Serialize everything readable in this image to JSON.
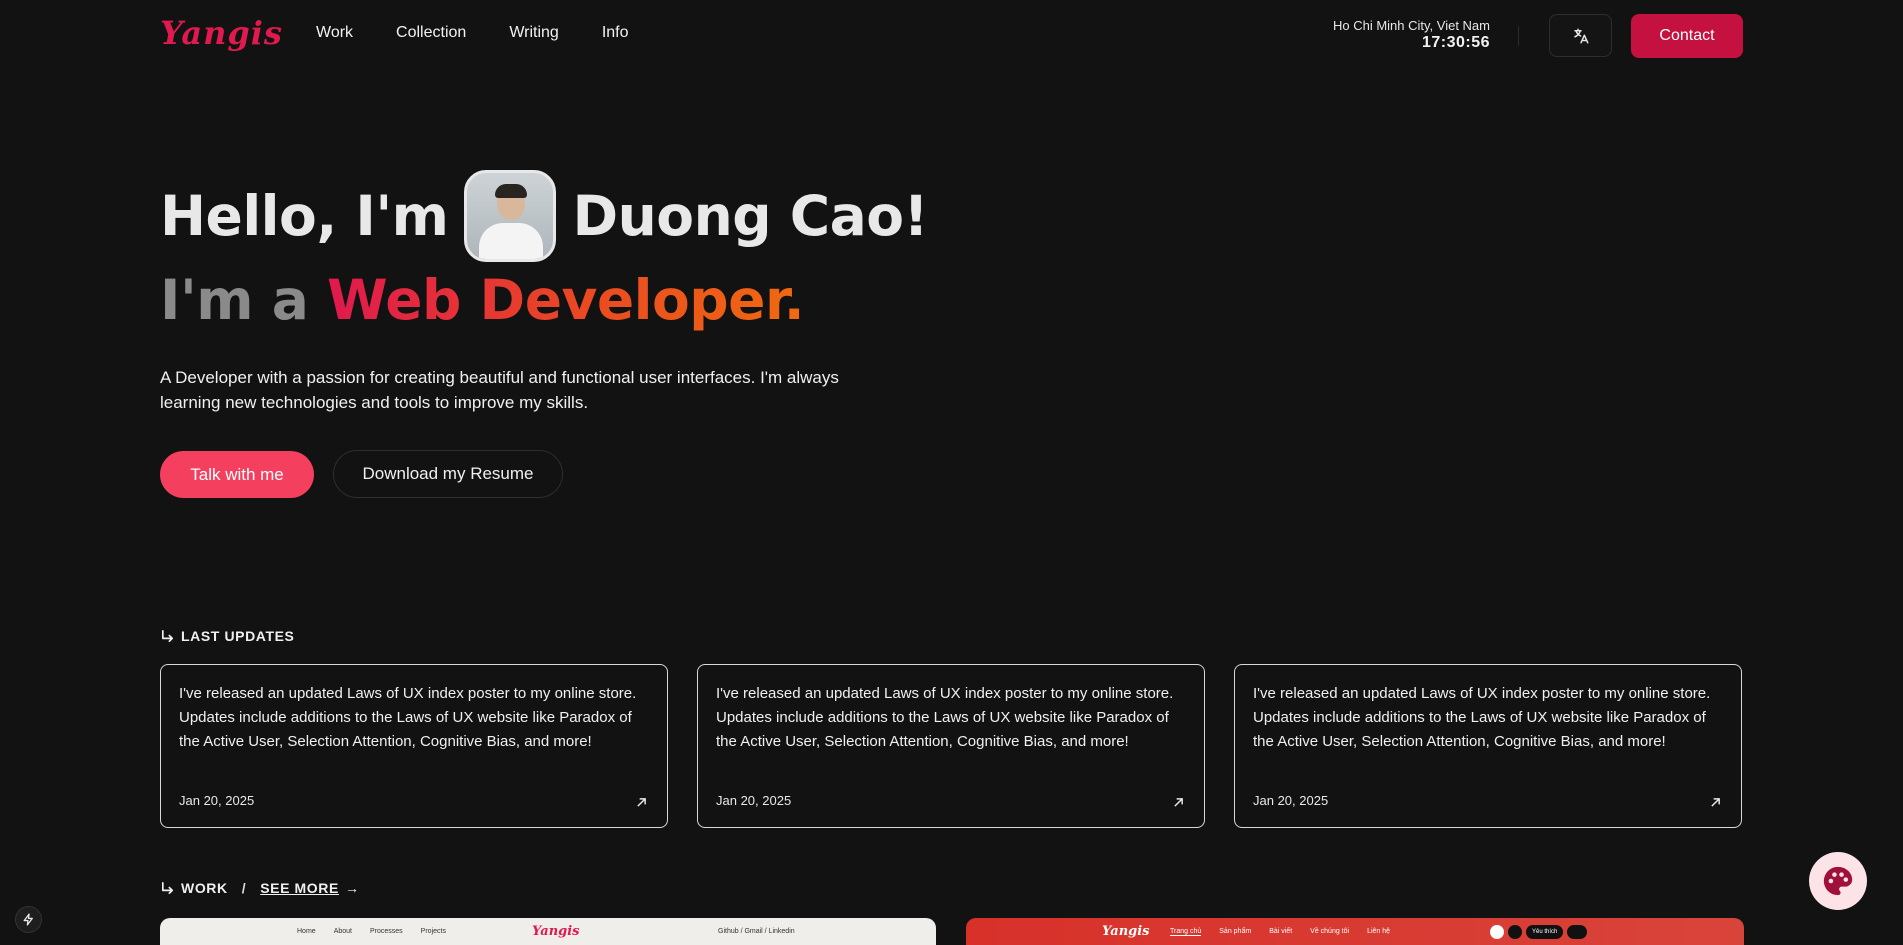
{
  "header": {
    "logo": "Yangis",
    "nav": [
      "Work",
      "Collection",
      "Writing",
      "Info"
    ],
    "city": "Ho Chi Minh City, Viet Nam",
    "clock": "17:30:56",
    "contact_label": "Contact"
  },
  "hero": {
    "greeting_pre": "Hello, I'm",
    "greeting_name": "Duong Cao!",
    "role_pre": "I'm a",
    "role": "Web Developer.",
    "description": "A Developer with a passion for creating beautiful and functional user interfaces. I'm always learning new technologies and tools to improve my skills.",
    "talk_label": "Talk with me",
    "resume_label": "Download my Resume"
  },
  "updates": {
    "heading": "LAST UPDATES",
    "items": [
      {
        "text": "I've released an updated Laws of UX index poster to my online store. Updates include additions to the Laws of UX website like Paradox of the Active User, Selection Attention, Cognitive Bias, and more!",
        "date": "Jan 20, 2025"
      },
      {
        "text": "I've released an updated Laws of UX index poster to my online store. Updates include additions to the Laws of UX website like Paradox of the Active User, Selection Attention, Cognitive Bias, and more!",
        "date": "Jan 20, 2025"
      },
      {
        "text": "I've released an updated Laws of UX index poster to my online store. Updates include additions to the Laws of UX website like Paradox of the Active User, Selection Attention, Cognitive Bias, and more!",
        "date": "Jan 20, 2025"
      }
    ]
  },
  "work": {
    "heading": "WORK",
    "see_more": "SEE MORE",
    "preview_left": {
      "nav": [
        "Home",
        "About",
        "Processes",
        "Projects"
      ],
      "logo": "Yangis",
      "links": "Github  /  Gmail  /  Linkedin"
    },
    "preview_right": {
      "logo": "Yangis",
      "nav": [
        "Trang chủ",
        "Sản phẩm",
        "Bài viết",
        "Về chúng tôi",
        "Liên hệ"
      ],
      "wishlist": "Yêu thích"
    }
  },
  "icons": {
    "translate": "translate-icon",
    "arrow_up_right": "arrow-up-right-icon",
    "palette": "palette-icon",
    "bolt": "bolt-icon"
  },
  "colors": {
    "background": "#121212",
    "accent": "#e0194e",
    "contact_button": "#c4113f",
    "talk_button": "#f43f5e",
    "gradient_end": "#f06a10"
  }
}
